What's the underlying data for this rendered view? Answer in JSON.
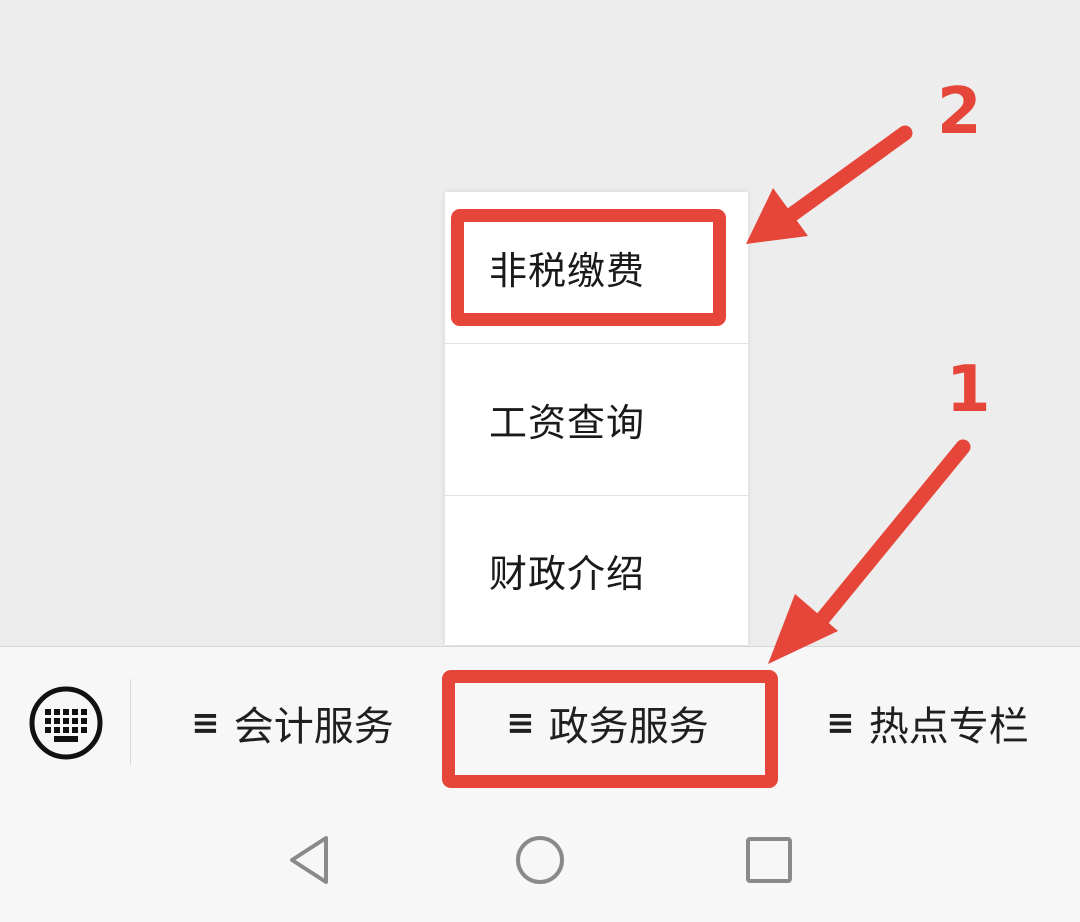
{
  "popup_menu": {
    "items": [
      {
        "label": "非税缴费"
      },
      {
        "label": "工资查询"
      },
      {
        "label": "财政介绍"
      }
    ]
  },
  "menu_bar": {
    "keyboard_icon": "keyboard-icon",
    "menu_glyph": "≡",
    "tabs": [
      {
        "label": "会计服务"
      },
      {
        "label": "政务服务"
      },
      {
        "label": "热点专栏"
      }
    ]
  },
  "nav_bar": {
    "icons": [
      "back-triangle-icon",
      "home-circle-icon",
      "recent-square-icon"
    ]
  },
  "annotations": {
    "color": "#e64639",
    "labels": [
      "1",
      "2"
    ]
  }
}
